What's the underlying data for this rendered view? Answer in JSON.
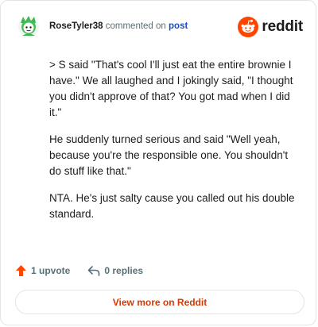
{
  "header": {
    "username": "RoseTyler38",
    "action_text": "commented on",
    "post_link": "post",
    "logo_text": "reddit"
  },
  "comment": {
    "paragraphs": [
      "> S said \"That's cool I'll just eat the entire brownie I have.\" We all laughed and I jokingly said, \"I thought you didn't approve of that? You got mad when I did it.\"",
      "He suddenly turned serious and said \"Well yeah, because you're the responsible one. You shouldn't do stuff like that.\"",
      "NTA. He's just salty cause you called out his double standard."
    ]
  },
  "actions": {
    "upvote_label": "1 upvote",
    "replies_label": "0 replies"
  },
  "footer": {
    "view_more_label": "View more on Reddit"
  },
  "colors": {
    "brand": "#ff4500",
    "link": "#1a4fb8",
    "view_more_text": "#d93900"
  }
}
